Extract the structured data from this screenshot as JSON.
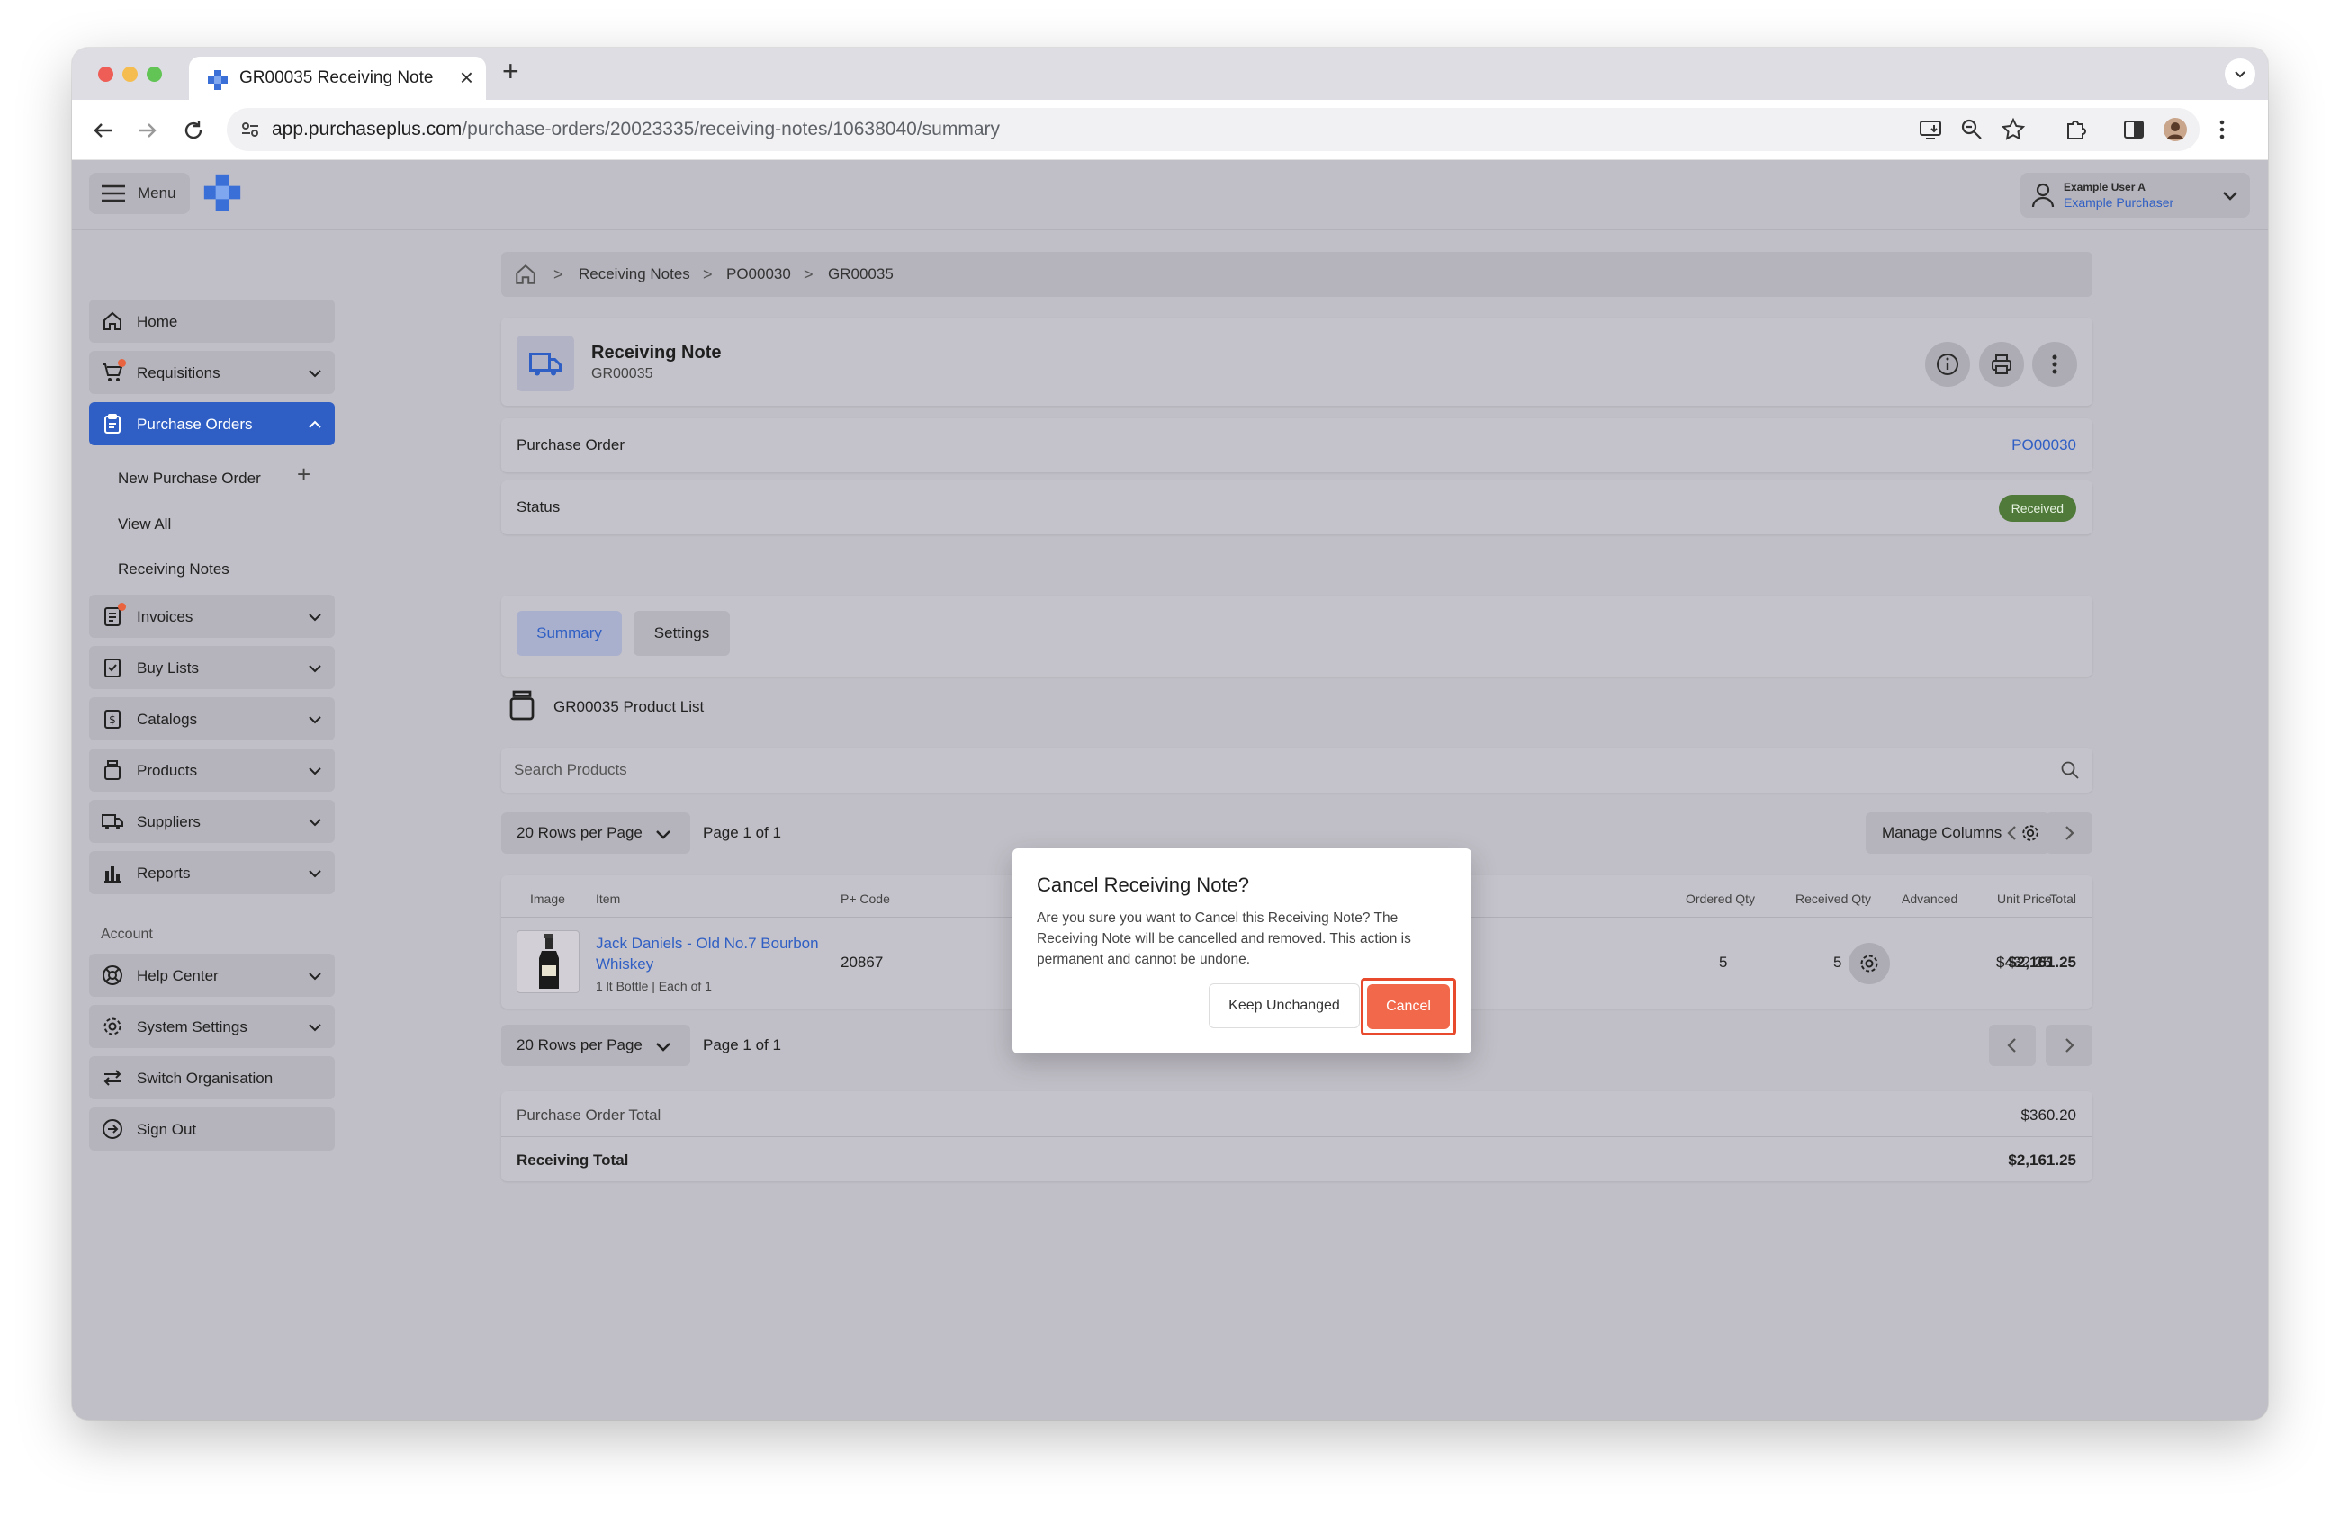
{
  "browser": {
    "tab_title": "GR00035 Receiving Note",
    "tab_close": "×",
    "new_tab": "+",
    "url_host": "app.purchaseplus.com",
    "url_path": "/purchase-orders/20023335/receiving-notes/10638040/summary"
  },
  "header": {
    "menu_label": "Menu",
    "user_name": "Example User A",
    "user_role": "Example Purchaser"
  },
  "sidebar": {
    "home": "Home",
    "requisitions": "Requisitions",
    "purchase_orders": "Purchase Orders",
    "new_purchase_order": "New Purchase Order",
    "new_purchase_order_plus": "+",
    "view_all": "View All",
    "receiving_notes": "Receiving Notes",
    "invoices": "Invoices",
    "buy_lists": "Buy Lists",
    "catalogs": "Catalogs",
    "products": "Products",
    "suppliers": "Suppliers",
    "reports": "Reports",
    "account_section": "Account",
    "help_center": "Help Center",
    "system_settings": "System Settings",
    "switch_organisation": "Switch Organisation",
    "sign_out": "Sign Out"
  },
  "breadcrumb": {
    "sep": ">",
    "items": [
      "Receiving Notes",
      "PO00030",
      "GR00035"
    ]
  },
  "receiving_note": {
    "title": "Receiving Note",
    "number": "GR00035",
    "purchase_order_label": "Purchase Order",
    "purchase_order_value": "PO00030",
    "status_label": "Status",
    "status_value": "Received"
  },
  "tabs": {
    "summary": "Summary",
    "settings": "Settings"
  },
  "product_list": {
    "title": "GR00035 Product List",
    "search_placeholder": "Search Products",
    "rows_per_page": "20 Rows per Page",
    "page_info": "Page 1 of 1",
    "manage_columns": "Manage Columns",
    "columns": {
      "image": "Image",
      "item": "Item",
      "pcode": "P+ Code",
      "ordered_qty": "Ordered Qty",
      "received_qty": "Received Qty",
      "advanced": "Advanced",
      "unit_price": "Unit Price",
      "total": "Total"
    },
    "rows": [
      {
        "item": "Jack Daniels - Old No.7 Bourbon Whiskey",
        "meta": "1 lt Bottle | Each of 1",
        "pcode": "20867",
        "ordered_qty": "5",
        "received_qty": "5",
        "unit_price": "$432.25",
        "total": "$2,161.25"
      }
    ]
  },
  "totals": {
    "po_total_label": "Purchase Order Total",
    "po_total_value": "$360.20",
    "receiving_total_label": "Receiving Total",
    "receiving_total_value": "$2,161.25"
  },
  "modal": {
    "title": "Cancel Receiving Note?",
    "body": "Are you sure you want to Cancel this Receiving Note? The Receiving Note will be cancelled and removed. This action is permanent and cannot be undone.",
    "keep_label": "Keep Unchanged",
    "cancel_label": "Cancel"
  },
  "colors": {
    "brand_blue": "#2f5fc4",
    "status_green": "#4f7a3a",
    "danger": "#f2684a",
    "highlight": "#e74a2d"
  }
}
